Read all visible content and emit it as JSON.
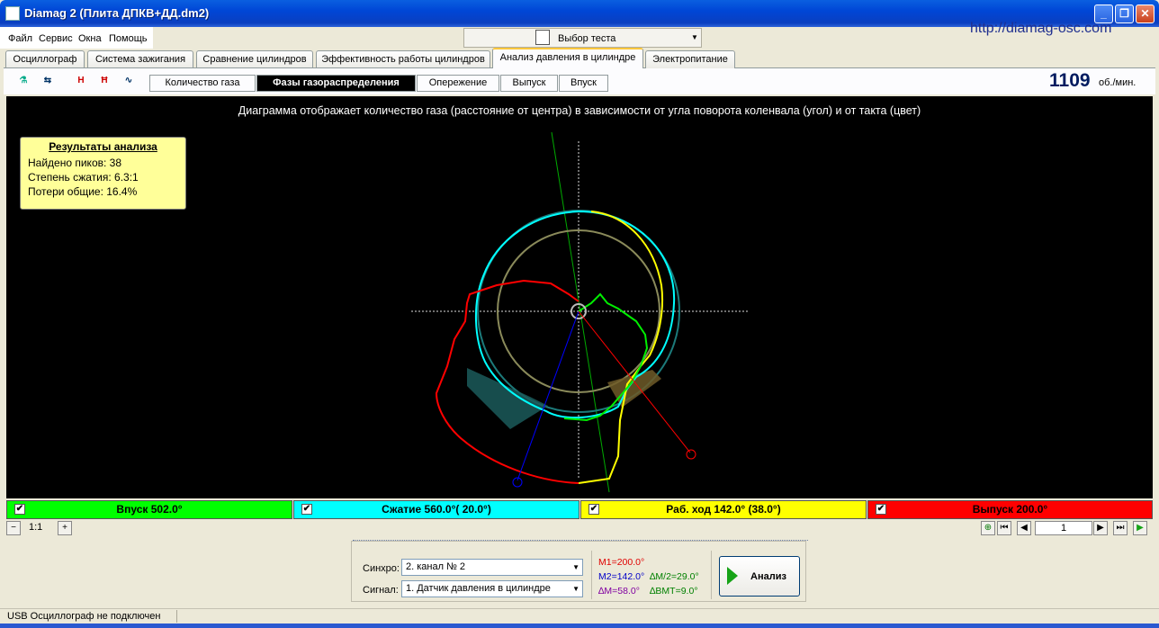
{
  "window": {
    "title": "Diamag 2 (Плита ДПКВ+ДД.dm2)",
    "buttons": {
      "minimize": "_",
      "restore": "❐",
      "close": "✕"
    }
  },
  "menu": [
    "Файл",
    "Сервис",
    "Окна",
    "Помощь"
  ],
  "url": "http://diamag-osc.com",
  "test_select": {
    "label": "Выбор теста"
  },
  "tabs": [
    "Осциллограф",
    "Система зажигания",
    "Сравнение цилиндров",
    "Эффективность работы цилиндров",
    "Анализ давления в цилиндре",
    "Электропитание"
  ],
  "active_tab": "Анализ давления в цилиндре",
  "subtabs": [
    "Количество газа",
    "Фазы газораспределения",
    "Опережение",
    "Выпуск",
    "Впуск"
  ],
  "active_subtab": "Фазы газораспределения",
  "rpm": {
    "value": "1109",
    "unit": "об./мин."
  },
  "plot": {
    "caption": "Диаграмма отображает количество газа (расстояние от центра) в зависимости от угла поворота коленвала (угол) и от такта (цвет)"
  },
  "results": {
    "title": "Результаты анализа",
    "lines": [
      "Найдено пиков: 38",
      "Степень сжатия: 6.3:1",
      "Потери общие: 16.4%"
    ]
  },
  "phases": [
    {
      "label": "Впуск 502.0°",
      "color": "#00ff00",
      "checked": "✔"
    },
    {
      "label": "Сжатие 560.0°( 20.0°)",
      "color": "#00ffff",
      "checked": "✔"
    },
    {
      "label": "Раб. ход 142.0° (38.0°)",
      "color": "#ffff00",
      "checked": "✔"
    },
    {
      "label": "Выпуск 200.0°",
      "color": "#ff0000",
      "checked": "✔"
    }
  ],
  "zoom": {
    "label": "1:1",
    "page": "1"
  },
  "bottom": {
    "sync_label": "Синхро:",
    "sync_value": "2.  канал № 2",
    "signal_label": "Сигнал:",
    "signal_value": "1.  Датчик давления в цилиндре",
    "m1": "M1=200.0°",
    "m2": "M2=142.0°",
    "dm2": "∆M/2=29.0°",
    "dm": "∆M=58.0°",
    "dvmt": "∆ВМТ=9.0°",
    "analyze": "Анализ"
  },
  "status": "USB Осциллограф не подключен"
}
